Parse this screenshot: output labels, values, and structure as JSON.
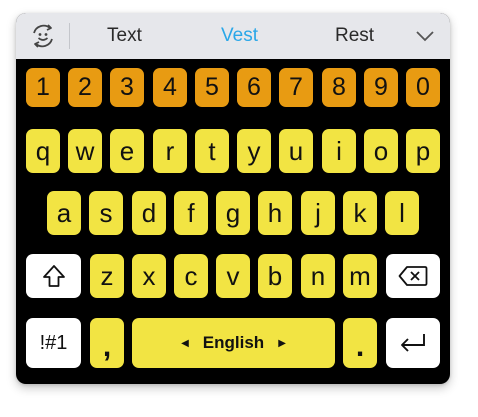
{
  "suggestions": {
    "items": [
      "Text",
      "Vest",
      "Rest"
    ],
    "active_index": 1,
    "active_color": "#2aa7e8",
    "left_icon": "emoji-sync-icon",
    "right_icon": "chevron-down-icon"
  },
  "keys": {
    "numbers": [
      "1",
      "2",
      "3",
      "4",
      "5",
      "6",
      "7",
      "8",
      "9",
      "0"
    ],
    "row1": [
      "q",
      "w",
      "e",
      "r",
      "t",
      "y",
      "u",
      "i",
      "o",
      "p"
    ],
    "row2": [
      "a",
      "s",
      "d",
      "f",
      "g",
      "h",
      "j",
      "k",
      "l"
    ],
    "row3": [
      "z",
      "x",
      "c",
      "v",
      "b",
      "n",
      "m"
    ],
    "shift_icon": "shift-arrow-icon",
    "backspace_icon": "backspace-icon",
    "symbols_label": "!#1",
    "comma_label": ",",
    "space_label": "English",
    "space_left_arrow": "◀",
    "space_right_arrow": "▶",
    "period_label": ".",
    "enter_icon": "enter-icon"
  },
  "colors": {
    "number_keys": "#e89b12",
    "letter_keys": "#f2e443",
    "function_keys": "#ffffff",
    "keyboard_background": "#000000",
    "suggestion_bar": "#e6e7eb"
  }
}
